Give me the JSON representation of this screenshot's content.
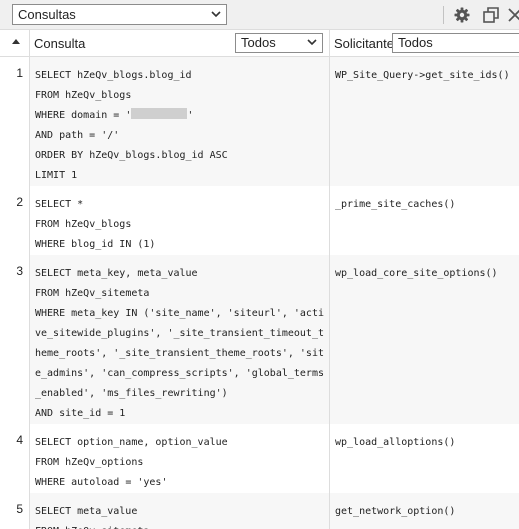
{
  "toolbar": {
    "panel_selected": "Consultas",
    "settings_icon": "gear-icon",
    "detach_icon": "window-detach-icon",
    "close_icon": "close-icon"
  },
  "header": {
    "sort_icon": "sort-ascending-icon",
    "query_label": "Consulta",
    "query_filter_value": "Todos",
    "caller_label": "Solicitante",
    "caller_filter_value": "Todos"
  },
  "rows": [
    {
      "number": "1",
      "sql": [
        [
          "SELECT",
          " hZeQv_blogs.blog_id"
        ],
        [
          "FROM",
          " hZeQv_blogs"
        ],
        [
          "WHERE",
          " domain = '",
          "[redacted]",
          "'"
        ],
        [
          "AND",
          " path = '/'"
        ],
        [
          "ORDER BY",
          " hZeQv_blogs.blog_id ASC"
        ],
        [
          "LIMIT",
          " 1"
        ]
      ],
      "caller": "WP_Site_Query->get_site_ids()"
    },
    {
      "number": "2",
      "sql": [
        [
          "SELECT",
          " *"
        ],
        [
          "FROM",
          " hZeQv_blogs"
        ],
        [
          "WHERE",
          " blog_id IN (1)"
        ]
      ],
      "caller": "_prime_site_caches()"
    },
    {
      "number": "3",
      "sql": [
        [
          "SELECT",
          " meta_key, meta_value"
        ],
        [
          "FROM",
          " hZeQv_sitemeta"
        ],
        [
          "WHERE",
          " meta_key IN ('site_name', 'siteurl', 'acti"
        ],
        [
          "",
          "ve_sitewide_plugins', '_site_transient_timeout_t"
        ],
        [
          "",
          "heme_roots', '_site_transient_theme_roots', 'sit"
        ],
        [
          "",
          "e_admins', 'can_compress_scripts', 'global_terms"
        ],
        [
          "",
          "_enabled', 'ms_files_rewriting')"
        ],
        [
          "AND",
          " site_id = 1"
        ]
      ],
      "caller": "wp_load_core_site_options()"
    },
    {
      "number": "4",
      "sql": [
        [
          "SELECT",
          " option_name, option_value"
        ],
        [
          "FROM",
          " hZeQv_options"
        ],
        [
          "WHERE",
          " autoload = 'yes'"
        ]
      ],
      "caller": "wp_load_alloptions()"
    },
    {
      "number": "5",
      "sql": [
        [
          "SELECT",
          " meta_value"
        ],
        [
          "FROM",
          " hZeQv_sitemeta"
        ]
      ],
      "caller": "get_network_option()"
    }
  ]
}
